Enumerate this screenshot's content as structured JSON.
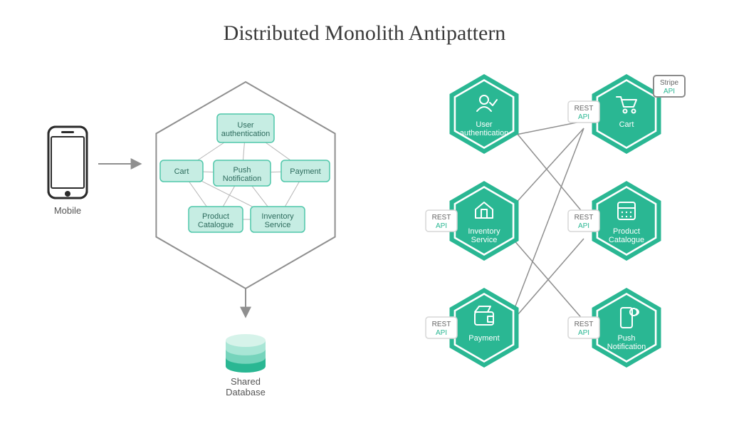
{
  "title": "Distributed Monolith Antipattern",
  "left": {
    "mobile_label": "Mobile",
    "db_label": "Shared\nDatabase",
    "modules": {
      "user_auth": "User\nauthentication",
      "cart": "Cart",
      "push": "Push\nNotification",
      "payment": "Payment",
      "catalogue": "Product\nCatalogue",
      "inventory": "Inventory\nService"
    }
  },
  "right": {
    "rest_top": "REST",
    "rest_bot": "API",
    "stripe_top": "Stripe",
    "stripe_bot": "API",
    "services": {
      "user_auth": "User\nauthentication",
      "cart": "Cart",
      "inventory": "Inventory\nService",
      "catalogue": "Product\nCatalogue",
      "payment": "Payment",
      "push": "Push\nNotification"
    }
  },
  "colors": {
    "heading": "#3a3a3a",
    "stroke": "#8f8f8f",
    "mintFill": "#c6ede3",
    "mintStroke": "#4fc7aa",
    "tealDark": "#2ab793",
    "tealLight": "#76d4bc",
    "textGrey": "#555555"
  }
}
